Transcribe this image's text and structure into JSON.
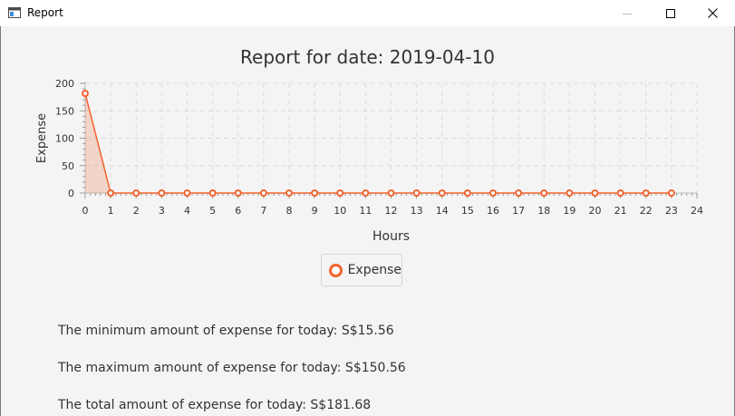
{
  "window": {
    "title": "Report",
    "controls": {
      "minimize": "—",
      "maximize": "☐",
      "close": "✕"
    }
  },
  "chart_data": {
    "type": "line",
    "title": "Report for date: 2019-04-10",
    "xlabel": "Hours",
    "ylabel": "Expense",
    "xlim": [
      0,
      24
    ],
    "ylim": [
      0,
      200
    ],
    "xticks": [
      "0",
      "1",
      "2",
      "3",
      "4",
      "5",
      "6",
      "7",
      "8",
      "9",
      "10",
      "11",
      "12",
      "13",
      "14",
      "15",
      "16",
      "17",
      "18",
      "19",
      "20",
      "21",
      "22",
      "23",
      "24"
    ],
    "yticks": [
      "0",
      "50",
      "100",
      "150",
      "200"
    ],
    "grid": true,
    "legend_position": "bottom",
    "series": [
      {
        "name": "Expense",
        "color": "#f3622d",
        "x": [
          0,
          1,
          2,
          3,
          4,
          5,
          6,
          7,
          8,
          9,
          10,
          11,
          12,
          13,
          14,
          15,
          16,
          17,
          18,
          19,
          20,
          21,
          22,
          23
        ],
        "values": [
          181.68,
          0,
          0,
          0,
          0,
          0,
          0,
          0,
          0,
          0,
          0,
          0,
          0,
          0,
          0,
          0,
          0,
          0,
          0,
          0,
          0,
          0,
          0,
          0
        ]
      }
    ]
  },
  "summary": {
    "min_text": "The minimum amount of expense for today: S$15.56",
    "max_text": "The maximum amount of expense for today: S$150.56",
    "total_text": "The total amount of expense for today: S$181.68"
  }
}
